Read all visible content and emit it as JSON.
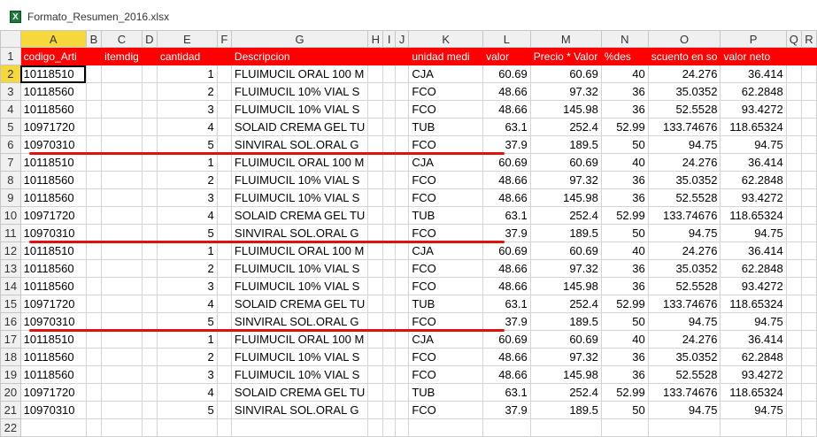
{
  "window": {
    "title": "Formato_Resumen_2016.xlsx",
    "icon": "excel-file-icon"
  },
  "column_headers": [
    "A",
    "B",
    "C",
    "D",
    "E",
    "F",
    "G",
    "H",
    "I",
    "J",
    "K",
    "L",
    "M",
    "N",
    "O",
    "P",
    "Q",
    "R"
  ],
  "header_row": {
    "row_number": "1",
    "cells": [
      "codigo_Arti",
      "",
      "itemdig",
      "",
      "cantidad",
      "",
      "Descripcion",
      "",
      "",
      "",
      "unidad medi",
      "valor",
      "Precio * Valor",
      "%des",
      "scuento en so",
      "valor neto",
      "",
      ""
    ]
  },
  "rows": [
    {
      "n": "2",
      "cells": [
        "10118510",
        "",
        "",
        "",
        "1",
        "",
        "FLUIMUCIL ORAL 100 M",
        "",
        "",
        "",
        "CJA",
        "60.69",
        "60.69",
        "40",
        "24.276",
        "36.414",
        "",
        ""
      ]
    },
    {
      "n": "3",
      "cells": [
        "10118560",
        "",
        "",
        "",
        "2",
        "",
        "FLUIMUCIL 10% VIAL S",
        "",
        "",
        "",
        "FCO",
        "48.66",
        "97.32",
        "36",
        "35.0352",
        "62.2848",
        "",
        ""
      ]
    },
    {
      "n": "4",
      "cells": [
        "10118560",
        "",
        "",
        "",
        "3",
        "",
        "FLUIMUCIL 10% VIAL S",
        "",
        "",
        "",
        "FCO",
        "48.66",
        "145.98",
        "36",
        "52.5528",
        "93.4272",
        "",
        ""
      ]
    },
    {
      "n": "5",
      "cells": [
        "10971720",
        "",
        "",
        "",
        "4",
        "",
        "SOLAID CREMA GEL TU",
        "",
        "",
        "",
        "TUB",
        "63.1",
        "252.4",
        "52.99",
        "133.74676",
        "118.65324",
        "",
        ""
      ]
    },
    {
      "n": "6",
      "cells": [
        "10970310",
        "",
        "",
        "",
        "5",
        "",
        "SINVIRAL SOL.ORAL G",
        "",
        "",
        "",
        "FCO",
        "37.9",
        "189.5",
        "50",
        "94.75",
        "94.75",
        "",
        ""
      ]
    },
    {
      "n": "7",
      "cells": [
        "10118510",
        "",
        "",
        "",
        "1",
        "",
        "FLUIMUCIL ORAL 100 M",
        "",
        "",
        "",
        "CJA",
        "60.69",
        "60.69",
        "40",
        "24.276",
        "36.414",
        "",
        ""
      ]
    },
    {
      "n": "8",
      "cells": [
        "10118560",
        "",
        "",
        "",
        "2",
        "",
        "FLUIMUCIL 10% VIAL S",
        "",
        "",
        "",
        "FCO",
        "48.66",
        "97.32",
        "36",
        "35.0352",
        "62.2848",
        "",
        ""
      ]
    },
    {
      "n": "9",
      "cells": [
        "10118560",
        "",
        "",
        "",
        "3",
        "",
        "FLUIMUCIL 10% VIAL S",
        "",
        "",
        "",
        "FCO",
        "48.66",
        "145.98",
        "36",
        "52.5528",
        "93.4272",
        "",
        ""
      ]
    },
    {
      "n": "10",
      "cells": [
        "10971720",
        "",
        "",
        "",
        "4",
        "",
        "SOLAID CREMA GEL TU",
        "",
        "",
        "",
        "TUB",
        "63.1",
        "252.4",
        "52.99",
        "133.74676",
        "118.65324",
        "",
        ""
      ]
    },
    {
      "n": "11",
      "cells": [
        "10970310",
        "",
        "",
        "",
        "5",
        "",
        "SINVIRAL SOL.ORAL G",
        "",
        "",
        "",
        "FCO",
        "37.9",
        "189.5",
        "50",
        "94.75",
        "94.75",
        "",
        ""
      ]
    },
    {
      "n": "12",
      "cells": [
        "10118510",
        "",
        "",
        "",
        "1",
        "",
        "FLUIMUCIL ORAL 100 M",
        "",
        "",
        "",
        "CJA",
        "60.69",
        "60.69",
        "40",
        "24.276",
        "36.414",
        "",
        ""
      ]
    },
    {
      "n": "13",
      "cells": [
        "10118560",
        "",
        "",
        "",
        "2",
        "",
        "FLUIMUCIL 10% VIAL S",
        "",
        "",
        "",
        "FCO",
        "48.66",
        "97.32",
        "36",
        "35.0352",
        "62.2848",
        "",
        ""
      ]
    },
    {
      "n": "14",
      "cells": [
        "10118560",
        "",
        "",
        "",
        "3",
        "",
        "FLUIMUCIL 10% VIAL S",
        "",
        "",
        "",
        "FCO",
        "48.66",
        "145.98",
        "36",
        "52.5528",
        "93.4272",
        "",
        ""
      ]
    },
    {
      "n": "15",
      "cells": [
        "10971720",
        "",
        "",
        "",
        "4",
        "",
        "SOLAID CREMA GEL TU",
        "",
        "",
        "",
        "TUB",
        "63.1",
        "252.4",
        "52.99",
        "133.74676",
        "118.65324",
        "",
        ""
      ]
    },
    {
      "n": "16",
      "cells": [
        "10970310",
        "",
        "",
        "",
        "5",
        "",
        "SINVIRAL SOL.ORAL G",
        "",
        "",
        "",
        "FCO",
        "37.9",
        "189.5",
        "50",
        "94.75",
        "94.75",
        "",
        ""
      ]
    },
    {
      "n": "17",
      "cells": [
        "10118510",
        "",
        "",
        "",
        "1",
        "",
        "FLUIMUCIL ORAL 100 M",
        "",
        "",
        "",
        "CJA",
        "60.69",
        "60.69",
        "40",
        "24.276",
        "36.414",
        "",
        ""
      ]
    },
    {
      "n": "18",
      "cells": [
        "10118560",
        "",
        "",
        "",
        "2",
        "",
        "FLUIMUCIL 10% VIAL S",
        "",
        "",
        "",
        "FCO",
        "48.66",
        "97.32",
        "36",
        "35.0352",
        "62.2848",
        "",
        ""
      ]
    },
    {
      "n": "19",
      "cells": [
        "10118560",
        "",
        "",
        "",
        "3",
        "",
        "FLUIMUCIL 10% VIAL S",
        "",
        "",
        "",
        "FCO",
        "48.66",
        "145.98",
        "36",
        "52.5528",
        "93.4272",
        "",
        ""
      ]
    },
    {
      "n": "20",
      "cells": [
        "10971720",
        "",
        "",
        "",
        "4",
        "",
        "SOLAID CREMA GEL TU",
        "",
        "",
        "",
        "TUB",
        "63.1",
        "252.4",
        "52.99",
        "133.74676",
        "118.65324",
        "",
        ""
      ]
    },
    {
      "n": "21",
      "cells": [
        "10970310",
        "",
        "",
        "",
        "5",
        "",
        "SINVIRAL SOL.ORAL G",
        "",
        "",
        "",
        "FCO",
        "37.9",
        "189.5",
        "50",
        "94.75",
        "94.75",
        "",
        ""
      ]
    },
    {
      "n": "22",
      "cells": [
        "",
        "",
        "",
        "",
        "",
        "",
        "",
        "",
        "",
        "",
        "",
        "",
        "",
        "",
        "",
        "",
        "",
        ""
      ]
    }
  ],
  "selection": {
    "active_cell": "A2"
  },
  "annotations": {
    "underline_after_rows": [
      "6",
      "11",
      "16"
    ],
    "color": "#e01010"
  },
  "colors": {
    "header_fill": "#ff0000",
    "header_text": "#ffffff",
    "selected_header": "#f7d83c"
  }
}
